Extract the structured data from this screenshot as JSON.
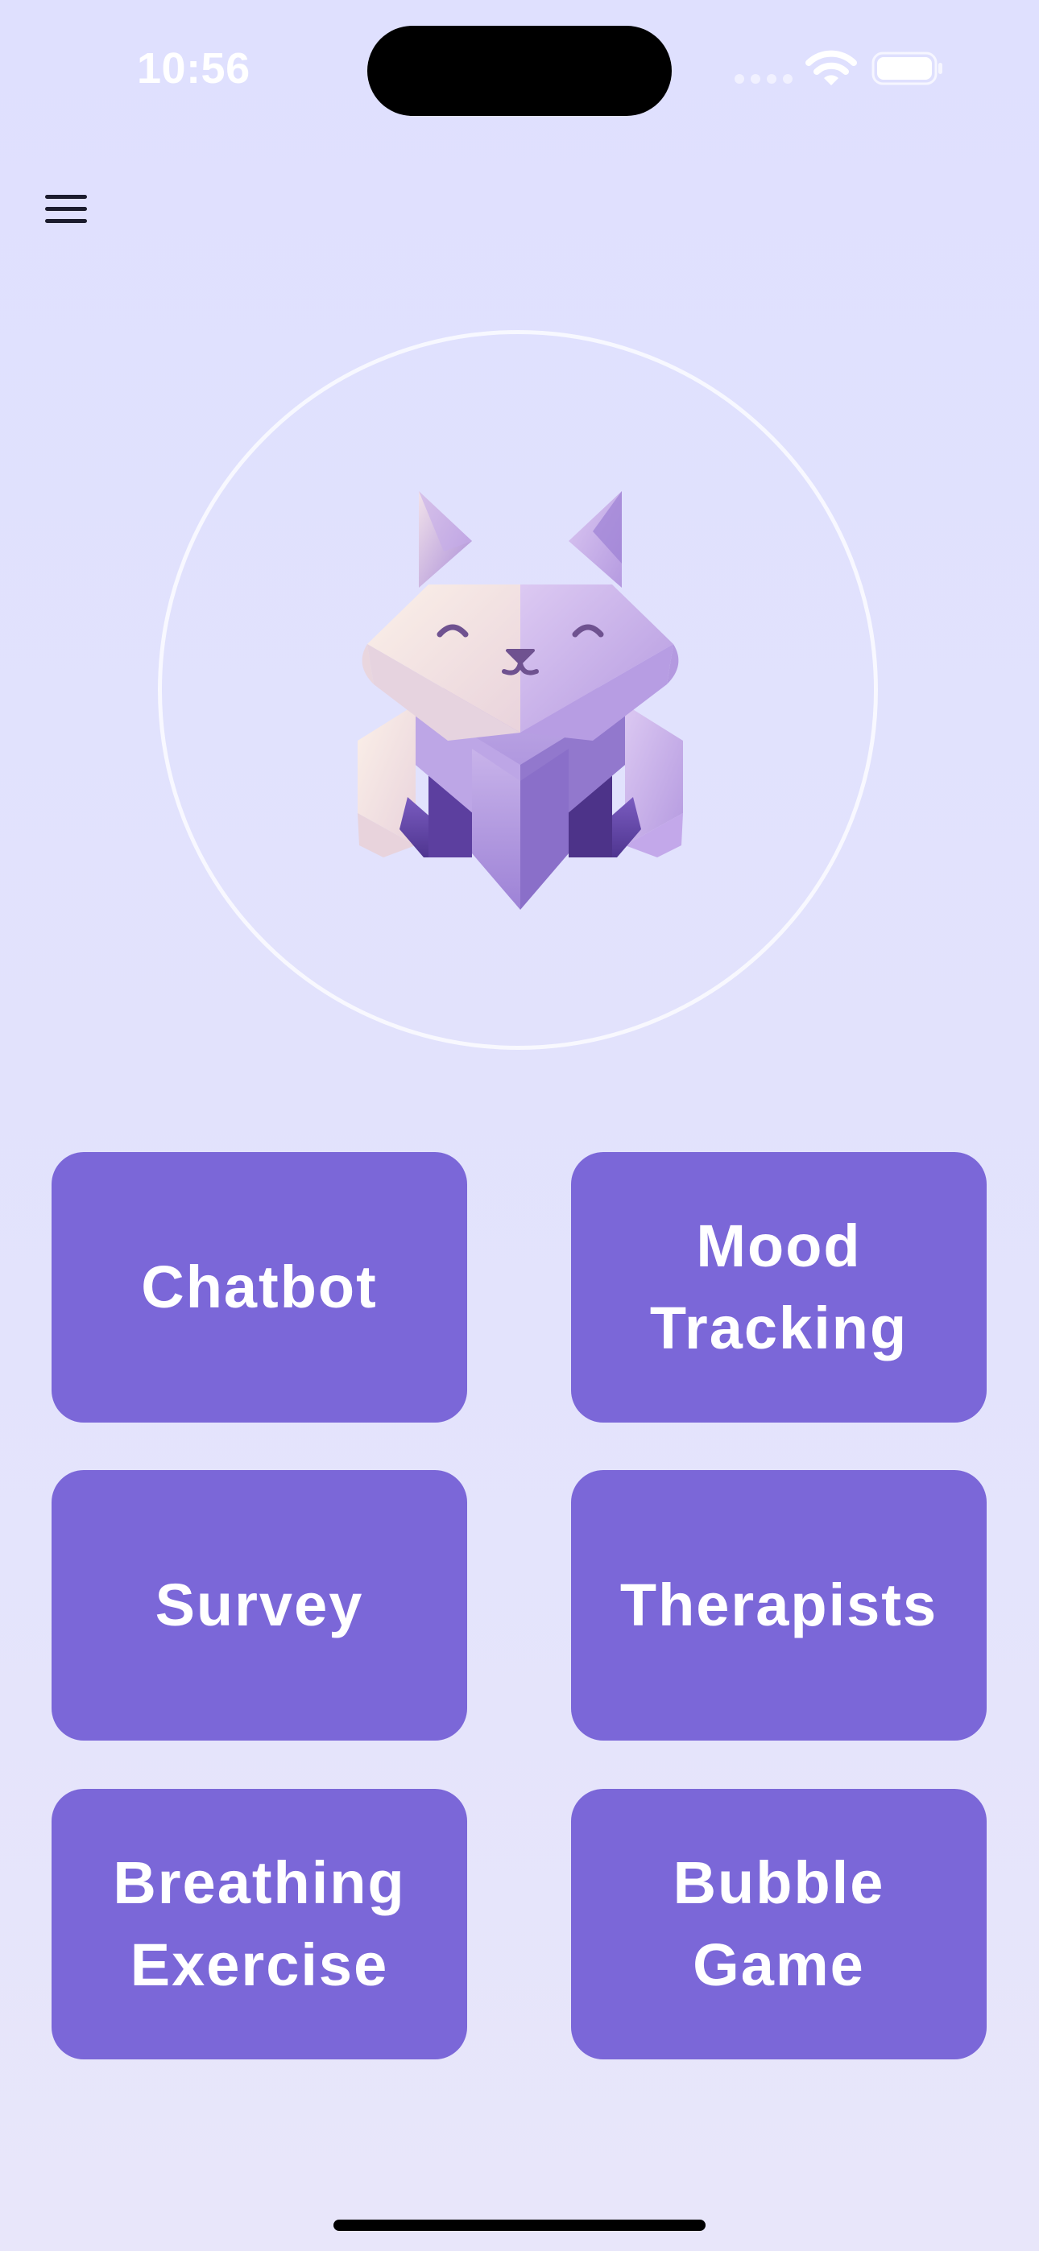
{
  "status_bar": {
    "time": "10:56",
    "icons": [
      "cellular-signal-icon",
      "wifi-icon",
      "battery-icon"
    ]
  },
  "nav": {
    "menu_icon": "hamburger-menu-icon"
  },
  "mascot": {
    "description_icon": "origami-cat-icon"
  },
  "tiles": [
    {
      "label": "Chatbot"
    },
    {
      "label": "Mood Tracking"
    },
    {
      "label": "Survey"
    },
    {
      "label": "Therapists"
    },
    {
      "label": "Breathing Exercise"
    },
    {
      "label": "Bubble Game"
    }
  ],
  "colors": {
    "background": "#dfe0fe",
    "tile": "#7b67d8",
    "tile_text": "#ffffff",
    "mascot_light": "#f6e6e0",
    "mascot_purple": "#9b7fd4",
    "mascot_dark": "#5a3f9a"
  }
}
